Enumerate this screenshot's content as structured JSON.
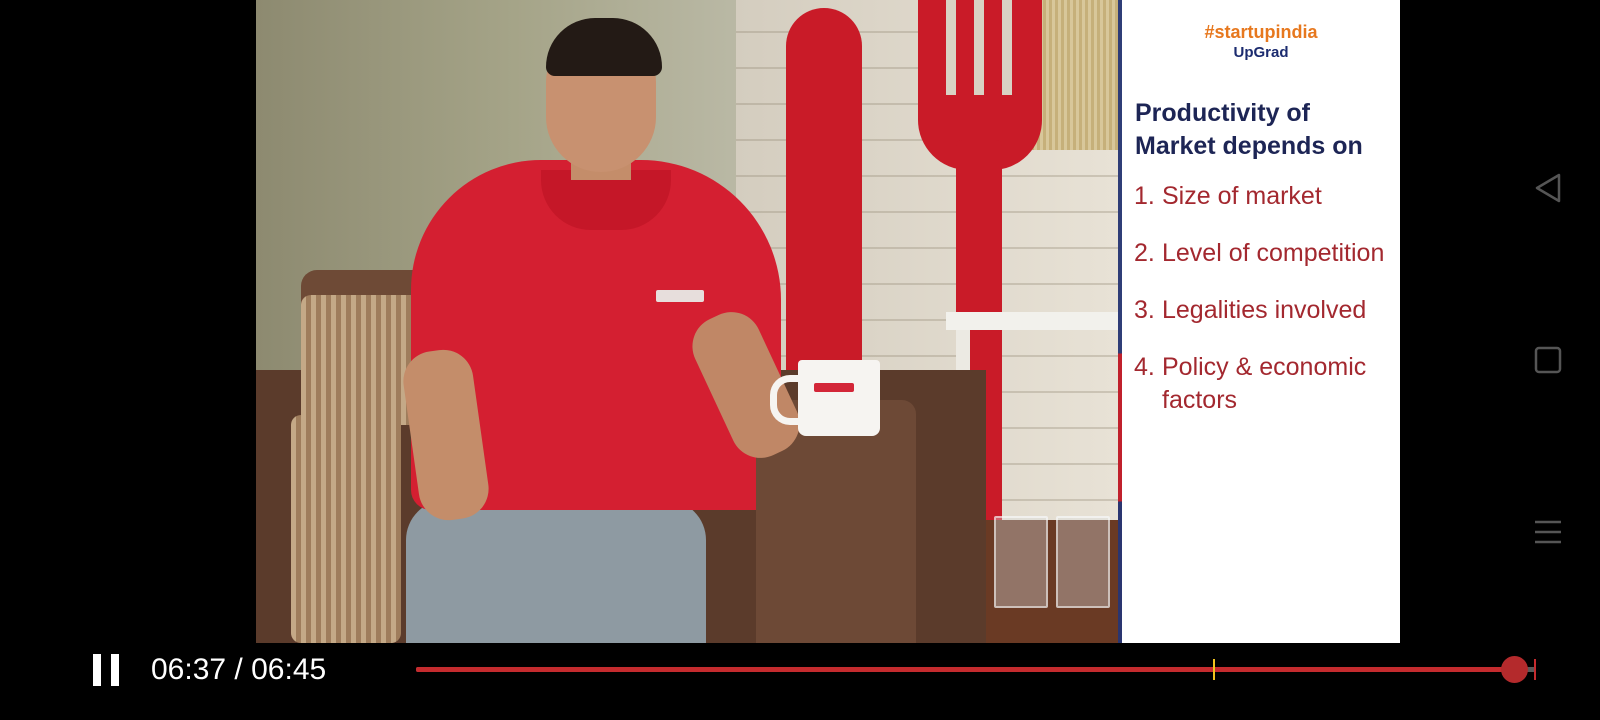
{
  "player": {
    "current_time": "06:37",
    "separator": "/",
    "duration": "06:45",
    "time_display": "06:37 / 06:45",
    "progress_fraction": 0.9802,
    "chapter_marker_fraction": 0.7118,
    "state": "playing"
  },
  "slide": {
    "brand_hashtag": "#startupindia",
    "brand_name": "UpGrad",
    "title": "Productivity of Market depends on",
    "items": [
      {
        "number": "1.",
        "text": "Size of market"
      },
      {
        "number": "2.",
        "text": "Level of competition"
      },
      {
        "number": "3.",
        "text": "Legalities involved"
      },
      {
        "number": "4.",
        "text": "Policy & economic factors"
      }
    ]
  },
  "colors": {
    "seek_progress": "#c52b2e",
    "seek_thumb": "#b42a2c",
    "chapter_marker": "#f0c21e",
    "slide_title": "#1d2555",
    "slide_items": "#a3282f"
  },
  "icons": {
    "pause": "pause-icon",
    "nav_back": "back-triangle-icon",
    "nav_home": "home-square-icon",
    "nav_recents": "recents-menu-icon"
  }
}
